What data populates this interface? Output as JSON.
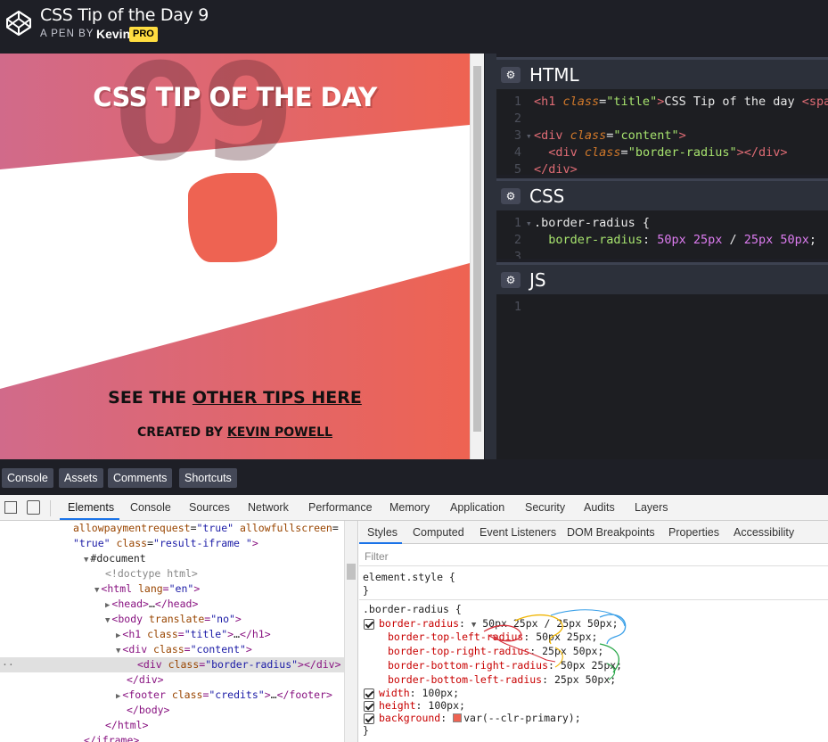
{
  "header": {
    "title": "CSS Tip of the Day 9",
    "by_prefix": "A PEN BY",
    "author": "Kevin",
    "badge": "PRO"
  },
  "preview": {
    "big_number": "09",
    "title": "CSS TIP OF THE DAY",
    "tips_prefix": "SEE THE ",
    "tips_link": "OTHER TIPS HERE",
    "credit_prefix": "CREATED BY ",
    "credit_link": "KEVIN POWELL",
    "colors": {
      "pink": "#d16a8a",
      "coral": "#ee6352",
      "box": "#ee6352"
    }
  },
  "editors": {
    "html": {
      "label": "HTML",
      "lines": [
        {
          "n": "1",
          "fold": "",
          "parts": [
            [
              "tag",
              "<h1 "
            ],
            [
              "attr",
              "class"
            ],
            [
              "op",
              "="
            ],
            [
              "val",
              "\"title\""
            ],
            [
              "tag",
              ">"
            ],
            [
              "txt",
              "CSS Tip of the day "
            ],
            [
              "tag",
              "<spa"
            ]
          ]
        },
        {
          "n": "2",
          "fold": "",
          "parts": []
        },
        {
          "n": "3",
          "fold": "▾",
          "parts": [
            [
              "tag",
              "<div "
            ],
            [
              "attr",
              "class"
            ],
            [
              "op",
              "="
            ],
            [
              "val",
              "\"content\""
            ],
            [
              "tag",
              ">"
            ]
          ]
        },
        {
          "n": "4",
          "fold": "",
          "parts": [
            [
              "txt",
              "  "
            ],
            [
              "tag",
              "<div "
            ],
            [
              "attr",
              "class"
            ],
            [
              "op",
              "="
            ],
            [
              "val",
              "\"border-radius\""
            ],
            [
              "tag",
              "></div>"
            ]
          ]
        },
        {
          "n": "5",
          "fold": "",
          "parts": [
            [
              "tag",
              "</div>"
            ]
          ]
        }
      ]
    },
    "css": {
      "label": "CSS",
      "lines": [
        {
          "n": "1",
          "fold": "▾",
          "parts": [
            [
              "txt",
              ".border-radius {"
            ]
          ]
        },
        {
          "n": "2",
          "fold": "",
          "parts": [
            [
              "txt",
              "  "
            ],
            [
              "prop",
              "border-radius"
            ],
            [
              "op",
              ": "
            ],
            [
              "num",
              "50px 25px"
            ],
            [
              "op",
              " / "
            ],
            [
              "num",
              "25px 50px"
            ],
            [
              "op",
              ";"
            ]
          ]
        },
        {
          "n": "3",
          "fold": "",
          "parts": []
        }
      ]
    },
    "js": {
      "label": "JS",
      "lines": [
        {
          "n": "1",
          "fold": "",
          "parts": []
        }
      ]
    }
  },
  "bottom_bar": {
    "buttons": [
      "Console",
      "Assets",
      "Comments",
      "Shortcuts"
    ]
  },
  "devtools": {
    "tabs": [
      "Elements",
      "Console",
      "Sources",
      "Network",
      "Performance",
      "Memory",
      "Application",
      "Security",
      "Audits",
      "Layers"
    ],
    "active_tab": "Elements",
    "dom_lines": [
      {
        "indent": 82,
        "parts": [
          [
            "dom-attr",
            "allowpaymentrequest"
          ],
          [
            "dom-txt",
            "="
          ],
          [
            "dom-val",
            "\"true\""
          ],
          [
            "dom-txt",
            " "
          ],
          [
            "dom-attr",
            "allowfullscreen"
          ],
          [
            "dom-txt",
            "="
          ]
        ]
      },
      {
        "indent": 82,
        "parts": [
          [
            "dom-val",
            "\"true\""
          ],
          [
            "dom-txt",
            " "
          ],
          [
            "dom-attr",
            "class"
          ],
          [
            "dom-txt",
            "="
          ],
          [
            "dom-val",
            "\"result-iframe \""
          ],
          [
            "dom-tag",
            ">"
          ]
        ]
      },
      {
        "indent": 94,
        "parts": [
          [
            "dom-arrow",
            "▼"
          ],
          [
            "dom-txt",
            "#document"
          ]
        ]
      },
      {
        "indent": 118,
        "parts": [
          [
            "dom-dim",
            "<!doctype html>"
          ]
        ]
      },
      {
        "indent": 106,
        "parts": [
          [
            "dom-arrow",
            "▼"
          ],
          [
            "dom-tag",
            "<html "
          ],
          [
            "dom-attr",
            "lang"
          ],
          [
            "dom-tag",
            "="
          ],
          [
            "dom-val",
            "\"en\""
          ],
          [
            "dom-tag",
            ">"
          ]
        ]
      },
      {
        "indent": 118,
        "parts": [
          [
            "dom-arrow",
            "▶"
          ],
          [
            "dom-tag",
            "<head>"
          ],
          [
            "dom-txt",
            "…"
          ],
          [
            "dom-tag",
            "</head>"
          ]
        ]
      },
      {
        "indent": 118,
        "parts": [
          [
            "dom-arrow",
            "▼"
          ],
          [
            "dom-tag",
            "<body "
          ],
          [
            "dom-attr",
            "translate"
          ],
          [
            "dom-tag",
            "="
          ],
          [
            "dom-val",
            "\"no\""
          ],
          [
            "dom-tag",
            ">"
          ]
        ]
      },
      {
        "indent": 130,
        "parts": [
          [
            "dom-arrow",
            "▶"
          ],
          [
            "dom-tag",
            "<h1 "
          ],
          [
            "dom-attr",
            "class"
          ],
          [
            "dom-tag",
            "="
          ],
          [
            "dom-val",
            "\"title\""
          ],
          [
            "dom-tag",
            ">"
          ],
          [
            "dom-txt",
            "…"
          ],
          [
            "dom-tag",
            "</h1>"
          ]
        ]
      },
      {
        "indent": 130,
        "parts": [
          [
            "dom-arrow",
            "▼"
          ],
          [
            "dom-tag",
            "<div "
          ],
          [
            "dom-attr",
            "class"
          ],
          [
            "dom-tag",
            "="
          ],
          [
            "dom-val",
            "\"content\""
          ],
          [
            "dom-tag",
            ">"
          ]
        ]
      },
      {
        "indent": 154,
        "selected": true,
        "parts": [
          [
            "dom-tag",
            "<div "
          ],
          [
            "dom-attr",
            "class"
          ],
          [
            "dom-tag",
            "="
          ],
          [
            "dom-val",
            "\"border-radius\""
          ],
          [
            "dom-tag",
            "></div>"
          ],
          [
            "dom-txt",
            " = "
          ]
        ]
      },
      {
        "indent": 142,
        "parts": [
          [
            "dom-tag",
            "</div>"
          ]
        ]
      },
      {
        "indent": 130,
        "parts": [
          [
            "dom-arrow",
            "▶"
          ],
          [
            "dom-tag",
            "<footer "
          ],
          [
            "dom-attr",
            "class"
          ],
          [
            "dom-tag",
            "="
          ],
          [
            "dom-val",
            "\"credits\""
          ],
          [
            "dom-tag",
            ">"
          ],
          [
            "dom-txt",
            "…"
          ],
          [
            "dom-tag",
            "</footer>"
          ]
        ]
      },
      {
        "indent": 142,
        "parts": [
          [
            "dom-tag",
            "</body>"
          ]
        ]
      },
      {
        "indent": 118,
        "parts": [
          [
            "dom-tag",
            "</html>"
          ]
        ]
      },
      {
        "indent": 94,
        "parts": [
          [
            "dom-tag",
            "</iframe>"
          ]
        ]
      }
    ],
    "styles_tabs": [
      "Styles",
      "Computed",
      "Event Listeners",
      "DOM Breakpoints",
      "Properties",
      "Accessibility"
    ],
    "filter_placeholder": "Filter",
    "element_style_open": "element.style {",
    "close_brace": "}",
    "rule_selector": ".border-radius {",
    "shorthand_prop": "border-radius",
    "shorthand_value": "50px 25px / 25px 50px;",
    "longhands": [
      {
        "prop": "border-top-left-radius",
        "value": "50px 25px;"
      },
      {
        "prop": "border-top-right-radius",
        "value": "25px 50px;"
      },
      {
        "prop": "border-bottom-right-radius",
        "value": "50px 25px;"
      },
      {
        "prop": "border-bottom-left-radius",
        "value": "25px 50px;"
      }
    ],
    "width_prop": "width",
    "width_value": "100px;",
    "height_prop": "height",
    "height_value": "100px;",
    "background_prop": "background",
    "background_value": "var(--clr-primary);"
  }
}
